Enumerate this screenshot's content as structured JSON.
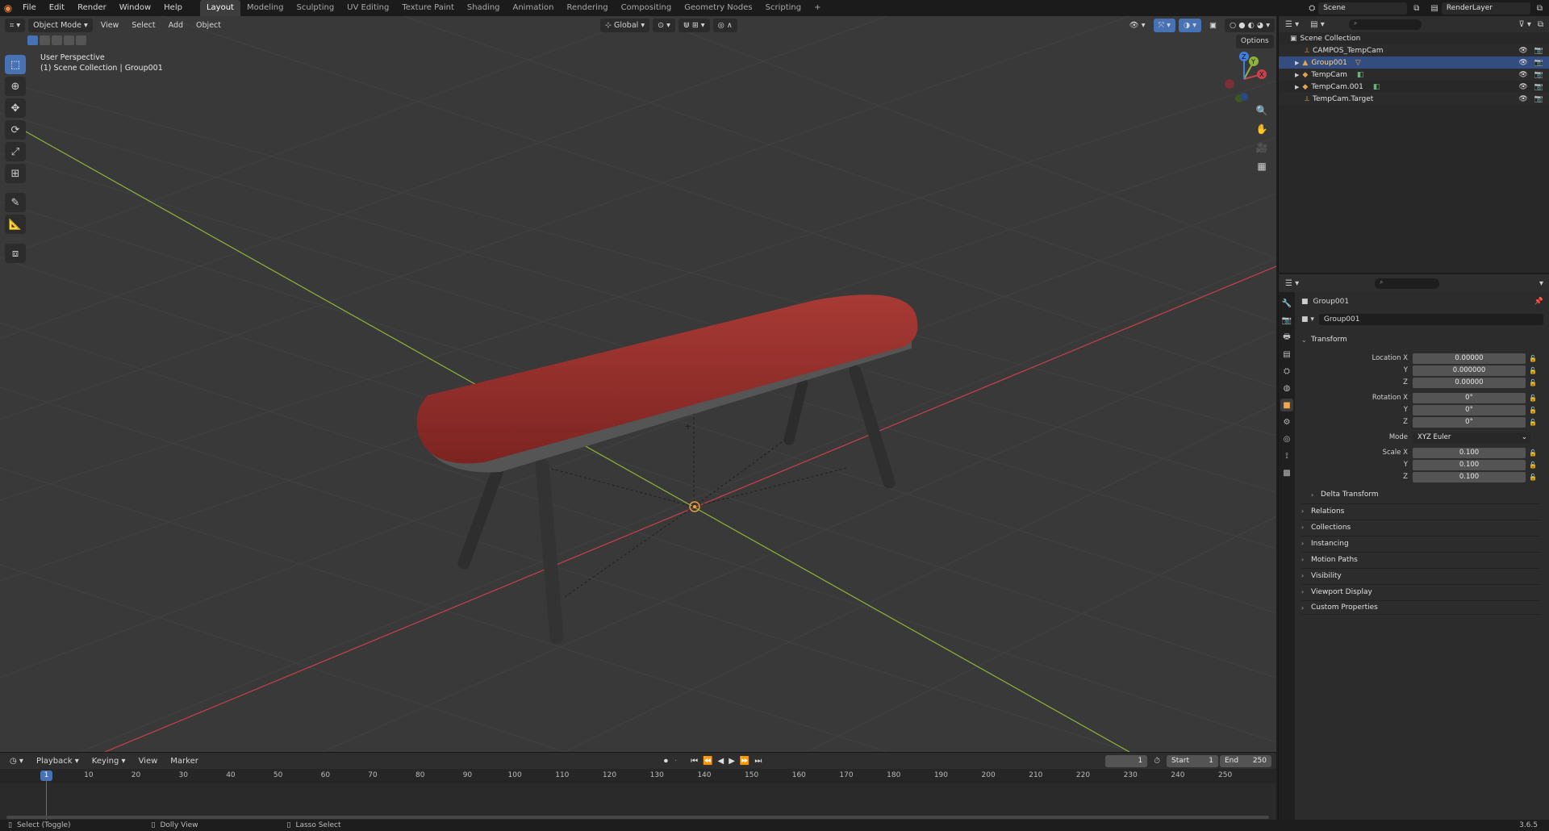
{
  "topbar": {
    "menus": [
      "File",
      "Edit",
      "Render",
      "Window",
      "Help"
    ],
    "workspaces": [
      "Layout",
      "Modeling",
      "Sculpting",
      "UV Editing",
      "Texture Paint",
      "Shading",
      "Animation",
      "Rendering",
      "Compositing",
      "Geometry Nodes",
      "Scripting"
    ],
    "active_workspace": "Layout",
    "add_tab_glyph": "+",
    "scene": "Scene",
    "view_layer": "RenderLayer"
  },
  "viewport": {
    "mode": "Object Mode",
    "menus": [
      "View",
      "Select",
      "Add",
      "Object"
    ],
    "transform_orientation": "Global",
    "options_label": "Options",
    "perspective_label": "User Perspective",
    "collection_label": "(1) Scene Collection | Group001",
    "gizmo_axes": {
      "x": "X",
      "y": "Y",
      "z": "Z"
    },
    "colors": {
      "x_axis": "#c8414b",
      "y_axis": "#8fb33a",
      "z_axis": "#3f7ee0",
      "seat": "#8e2b28",
      "legs": "#3a3a3a"
    }
  },
  "timeline": {
    "menus": [
      "Playback",
      "Keying",
      "View",
      "Marker"
    ],
    "current_frame": "1",
    "start_label": "Start",
    "start": "1",
    "end_label": "End",
    "end": "250",
    "ticks": [
      "10",
      "20",
      "30",
      "40",
      "50",
      "60",
      "70",
      "80",
      "90",
      "100",
      "110",
      "120",
      "130",
      "140",
      "150",
      "160",
      "170",
      "180",
      "190",
      "200",
      "210",
      "220",
      "230",
      "240",
      "250"
    ],
    "playhead_label": "1"
  },
  "status": {
    "select": "Select (Toggle)",
    "dolly": "Dolly View",
    "lasso": "Lasso Select",
    "version": "3.6.5"
  },
  "outliner": {
    "root": "Scene Collection",
    "items": [
      {
        "name": "CAMPOS_TempCam"
      },
      {
        "name": "Group001"
      },
      {
        "name": "TempCam"
      },
      {
        "name": "TempCam.001"
      },
      {
        "name": "TempCam.Target"
      }
    ],
    "selected": "Group001"
  },
  "properties": {
    "object_name": "Group001",
    "datablock_name": "Group001",
    "transform": {
      "title": "Transform",
      "location_label": "Location X",
      "location": [
        "0.00000",
        "0.000000",
        "0.00000"
      ],
      "rotation_label": "Rotation X",
      "rotation": [
        "0°",
        "0°",
        "0°"
      ],
      "mode_label": "Mode",
      "mode": "XYZ Euler",
      "scale_label": "Scale X",
      "scale": [
        "0.100",
        "0.100",
        "0.100"
      ],
      "y_label": "Y",
      "z_label": "Z"
    },
    "delta_transform": "Delta Transform",
    "panels": [
      "Relations",
      "Collections",
      "Instancing",
      "Motion Paths",
      "Visibility",
      "Viewport Display",
      "Custom Properties"
    ]
  }
}
